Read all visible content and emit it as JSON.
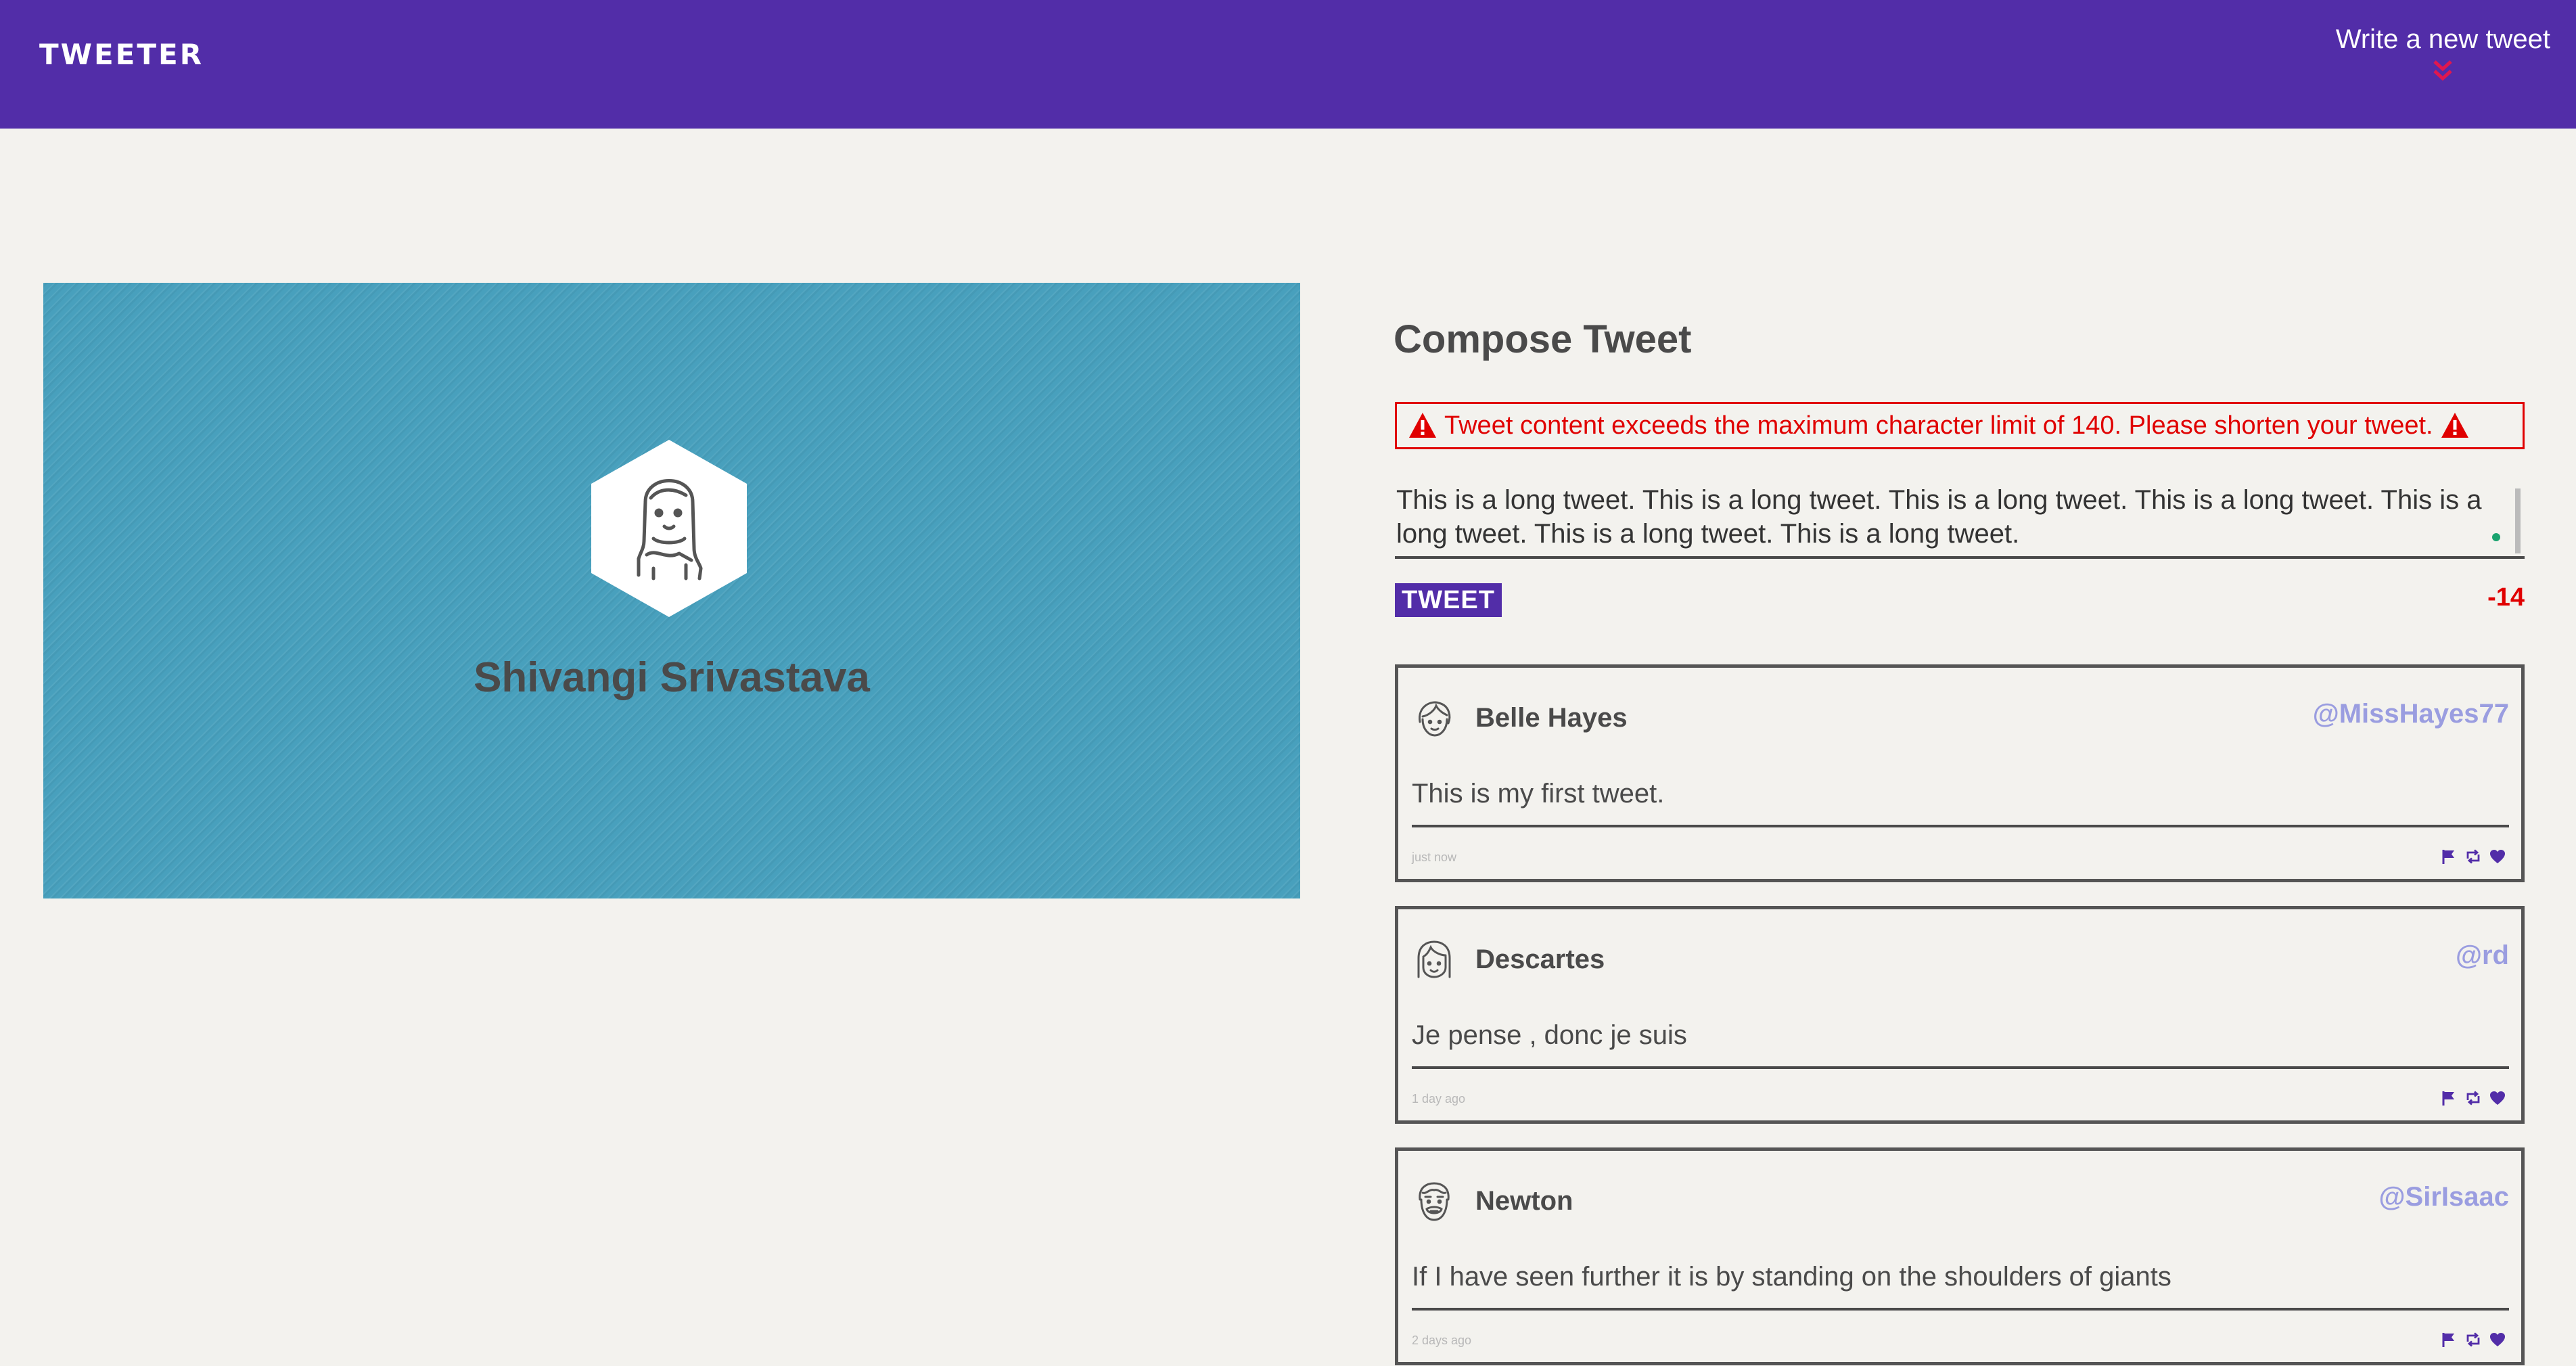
{
  "nav": {
    "brand": "TWEETER",
    "compose_label": "Write a new tweet",
    "compose_icon": "double-chevron-down-icon",
    "compose_icon_color": "#e0174f",
    "background": "#522da8"
  },
  "profile": {
    "name": "Shivangi Srivastava",
    "avatar_icon": "girl-avatar-icon",
    "background": "#48a0bd"
  },
  "compose": {
    "title": "Compose Tweet",
    "error_message": "Tweet content exceeds the maximum character limit of 140. Please shorten your tweet.",
    "error_icon": "warning-triangle-icon",
    "error_color": "#e00000",
    "textarea_value": "This is a long tweet. This is a long tweet. This is a long tweet. This is a long tweet. This is a long tweet. This is a long tweet. This is a long tweet.",
    "button_label": "TWEET",
    "counter": "-14"
  },
  "tweets": [
    {
      "name": "Belle Hayes",
      "handle": "@MissHayes77",
      "content": "This is my first tweet.",
      "time": "just now",
      "avatar_icon": "woman-avatar-icon"
    },
    {
      "name": "Descartes",
      "handle": "@rd",
      "content": "Je pense , donc je suis",
      "time": "1 day ago",
      "avatar_icon": "long-hair-avatar-icon"
    },
    {
      "name": "Newton",
      "handle": "@SirIsaac",
      "content": "If I have seen further it is by standing on the shoulders of giants",
      "time": "2 days ago",
      "avatar_icon": "bearded-man-avatar-icon"
    }
  ],
  "tweet_actions": [
    "flag-icon",
    "retweet-icon",
    "heart-icon"
  ],
  "accent_color": "#522da8",
  "handle_color": "#9a9de0"
}
